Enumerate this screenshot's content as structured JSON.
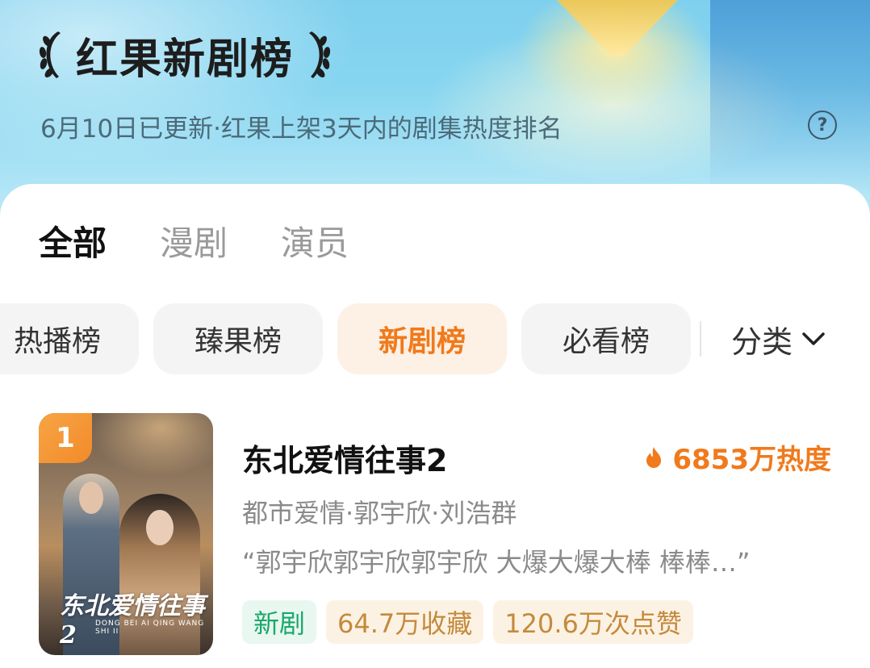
{
  "header": {
    "title": "红果新剧榜",
    "subtitle": "6月10日已更新·红果上架3天内的剧集热度排名",
    "help_glyph": "?"
  },
  "tabs": [
    {
      "label": "全部",
      "active": true
    },
    {
      "label": "漫剧",
      "active": false
    },
    {
      "label": "演员",
      "active": false
    }
  ],
  "chips": [
    {
      "label": "热播榜",
      "active": false
    },
    {
      "label": "臻果榜",
      "active": false
    },
    {
      "label": "新剧榜",
      "active": true
    },
    {
      "label": "必看榜",
      "active": false
    }
  ],
  "category": {
    "label": "分类"
  },
  "ranking": [
    {
      "rank": "1",
      "title": "东北爱情往事2",
      "heat": "6853万热度",
      "genres": "都市爱情·郭宇欣·刘浩群",
      "quote": "“郭宇欣郭宇欣郭宇欣 大爆大爆大棒 棒棒…”",
      "poster_title": "东北爱情往事2",
      "poster_subtitle": "DONG BEI AI QING WANG SHI II",
      "tags": [
        "新剧",
        "64.7万收藏",
        "120.6万次点赞"
      ]
    }
  ],
  "colors": {
    "accent": "#f07a1c",
    "new_tag": "#1aa86a",
    "stat_tag": "#c48a3c"
  }
}
